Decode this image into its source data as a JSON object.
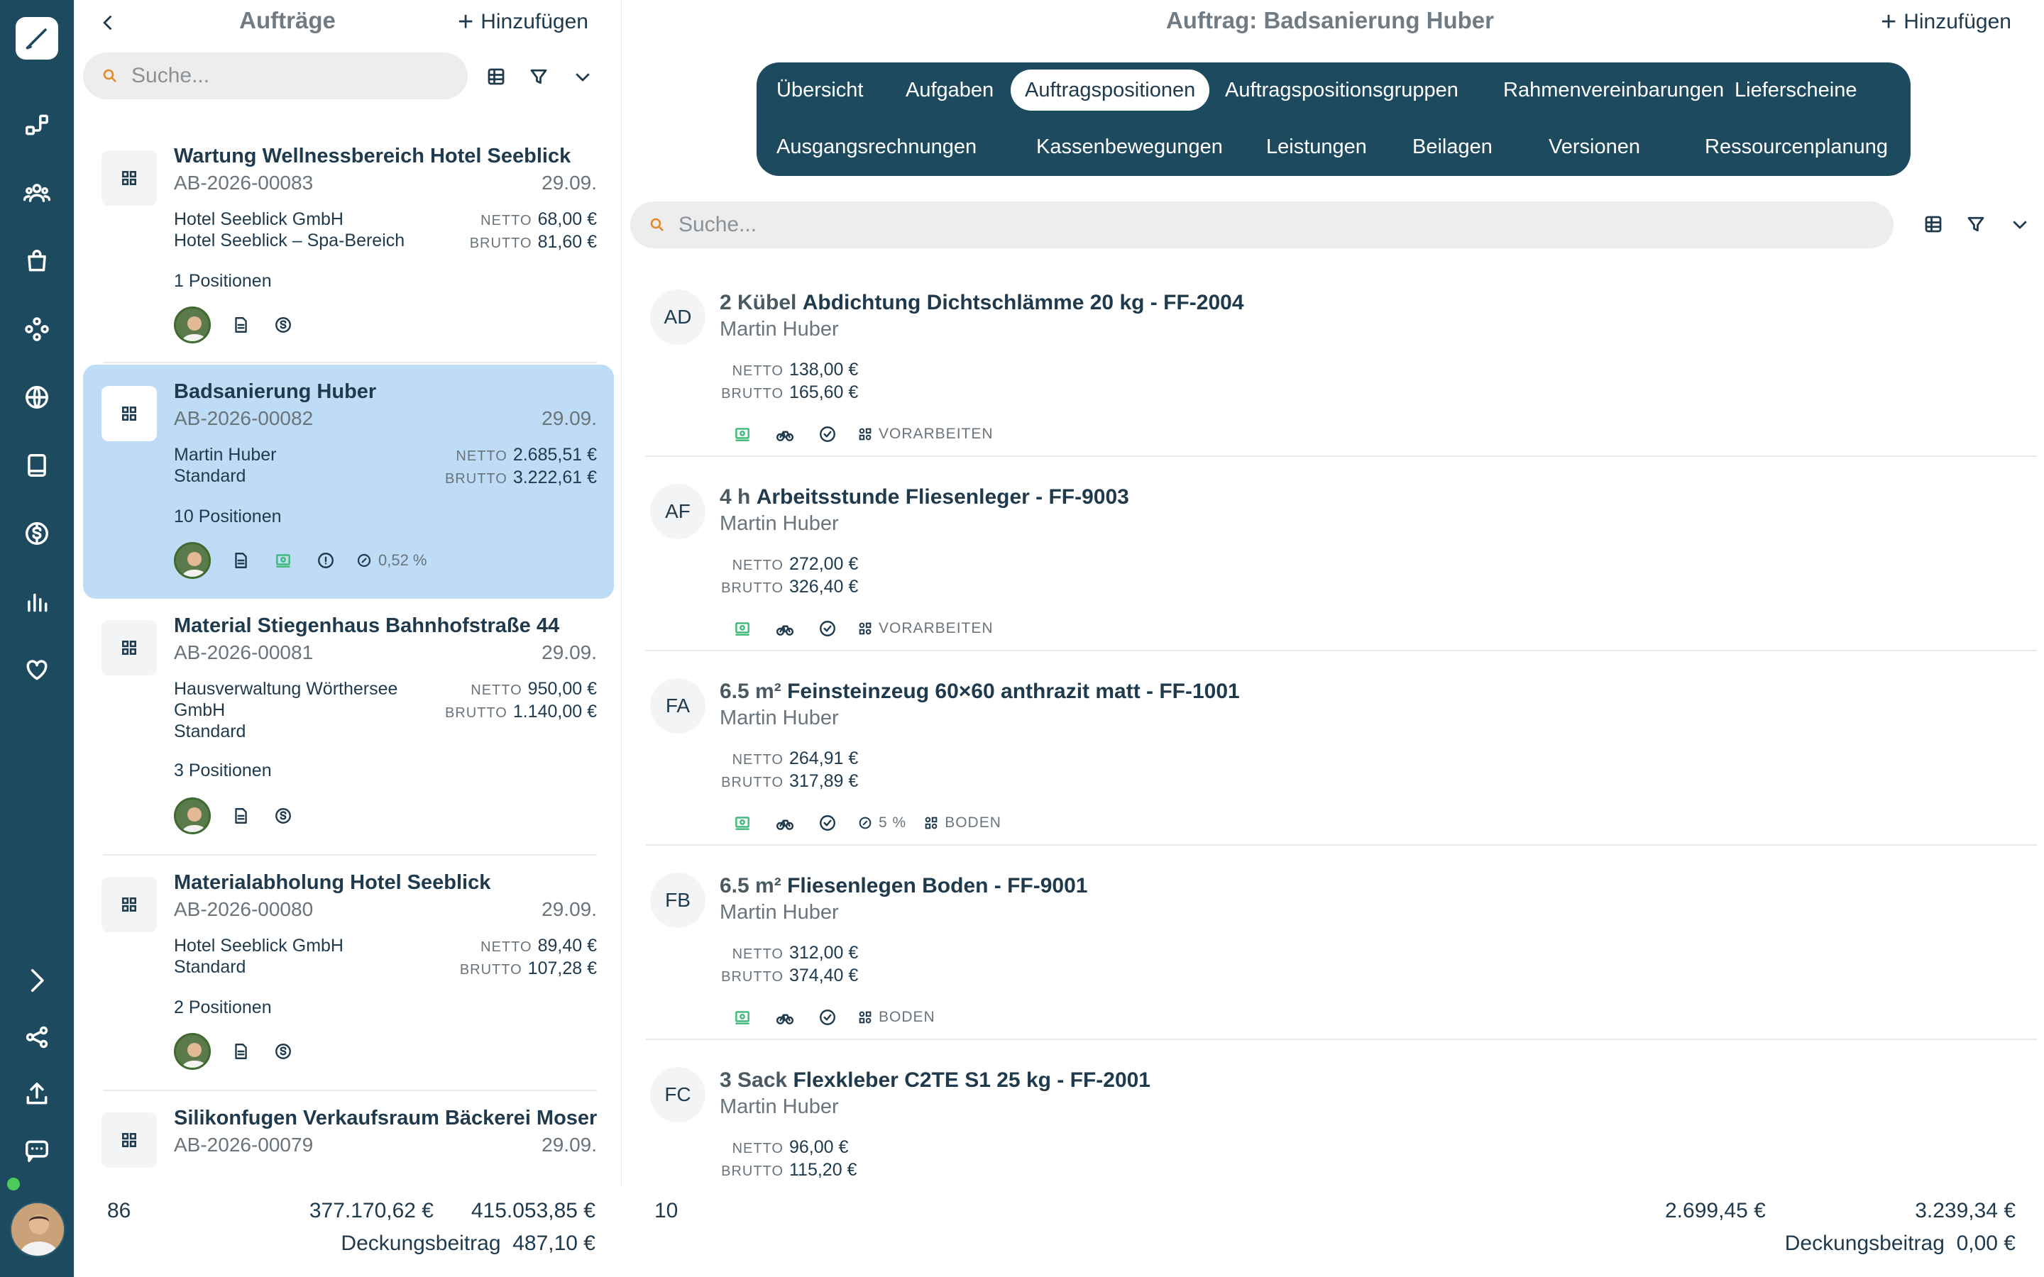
{
  "left_panel": {
    "title": "Aufträge",
    "add_label": "Hinzufügen",
    "search_placeholder": "Suche...",
    "orders": [
      {
        "title": "Wartung Wellnessbereich Hotel Seeblick",
        "number": "AB-2026-00083",
        "date": "29.09.",
        "customer": "Hotel Seeblick GmbH",
        "sub": "Hotel Seeblick – Spa-Bereich",
        "netto_label": "NETTO",
        "netto": "68,00 €",
        "brutto_label": "BRUTTO",
        "brutto": "81,60 €",
        "positions": "1 Positionen"
      },
      {
        "title": "Badsanierung Huber",
        "number": "AB-2026-00082",
        "date": "29.09.",
        "customer": "Martin Huber",
        "sub": "Standard",
        "netto_label": "NETTO",
        "netto": "2.685,51 €",
        "brutto_label": "BRUTTO",
        "brutto": "3.222,61 €",
        "positions": "10 Positionen",
        "percent": "0,52 %"
      },
      {
        "title": "Material Stiegenhaus Bahnhofstraße 44",
        "number": "AB-2026-00081",
        "date": "29.09.",
        "customer": "Hausverwaltung Wörthersee GmbH",
        "sub": "Standard",
        "netto_label": "NETTO",
        "netto": "950,00 €",
        "brutto_label": "BRUTTO",
        "brutto": "1.140,00 €",
        "positions": "3 Positionen"
      },
      {
        "title": "Materialabholung Hotel Seeblick",
        "number": "AB-2026-00080",
        "date": "29.09.",
        "customer": "Hotel Seeblick GmbH",
        "sub": "Standard",
        "netto_label": "NETTO",
        "netto": "89,40 €",
        "brutto_label": "BRUTTO",
        "brutto": "107,28 €",
        "positions": "2 Positionen"
      },
      {
        "title": "Silikonfugen Verkaufsraum Bäckerei Moser",
        "number": "AB-2026-00079",
        "date": "29.09."
      }
    ],
    "footer": {
      "count": "86",
      "netto": "377.170,62 €",
      "brutto": "415.053,85 €",
      "db_label": "Deckungsbeitrag",
      "db_value": "487,10 €"
    }
  },
  "right_panel": {
    "title": "Auftrag: Badsanierung Huber",
    "add_label": "Hinzufügen",
    "search_placeholder": "Suche...",
    "tabs_row1": [
      "Übersicht",
      "Aufgaben",
      "Auftragspositionen",
      "Auftragspositionsgruppen",
      "Rahmenvereinbarungen",
      "Lieferscheine"
    ],
    "tabs_row2": [
      "Ausgangsrechnungen",
      "Kassenbewegungen",
      "Leistungen",
      "Beilagen",
      "Versionen",
      "Ressourcenplanung"
    ],
    "active_tab": "Auftragspositionen",
    "items": [
      {
        "initials": "AD",
        "qty": "2 Kübel",
        "name": "Abdichtung Dichtschlämme 20 kg - FF-2004",
        "customer": "Martin Huber",
        "netto_label": "NETTO",
        "netto": "138,00 €",
        "brutto_label": "BRUTTO",
        "brutto": "165,60 €",
        "tag": "VORARBEITEN"
      },
      {
        "initials": "AF",
        "qty": "4 h",
        "name": "Arbeitsstunde Fliesenleger - FF-9003",
        "customer": "Martin Huber",
        "netto_label": "NETTO",
        "netto": "272,00 €",
        "brutto_label": "BRUTTO",
        "brutto": "326,40 €",
        "tag": "VORARBEITEN"
      },
      {
        "initials": "FA",
        "qty": "6.5 m²",
        "name": "Feinsteinzeug 60×60 anthrazit matt - FF-1001",
        "customer": "Martin Huber",
        "netto_label": "NETTO",
        "netto": "264,91 €",
        "brutto_label": "BRUTTO",
        "brutto": "317,89 €",
        "percent": "5 %",
        "tag": "BODEN"
      },
      {
        "initials": "FB",
        "qty": "6.5 m²",
        "name": "Fliesenlegen Boden - FF-9001",
        "customer": "Martin Huber",
        "netto_label": "NETTO",
        "netto": "312,00 €",
        "brutto_label": "BRUTTO",
        "brutto": "374,40 €",
        "tag": "BODEN"
      },
      {
        "initials": "FC",
        "qty": "3 Sack",
        "name": "Flexkleber C2TE S1 25 kg - FF-2001",
        "customer": "Martin Huber",
        "netto_label": "NETTO",
        "netto": "96,00 €",
        "brutto_label": "BRUTTO",
        "brutto": "115,20 €"
      }
    ],
    "footer": {
      "count": "10",
      "netto": "2.699,45 €",
      "brutto": "3.239,34 €",
      "db_label": "Deckungsbeitrag",
      "db_value": "0,00 €"
    }
  },
  "colors": {
    "sidebar": "#1d4a5f",
    "selected": "#bedcf5",
    "accent_green": "#3cb878",
    "text": "#1f3a4d"
  }
}
